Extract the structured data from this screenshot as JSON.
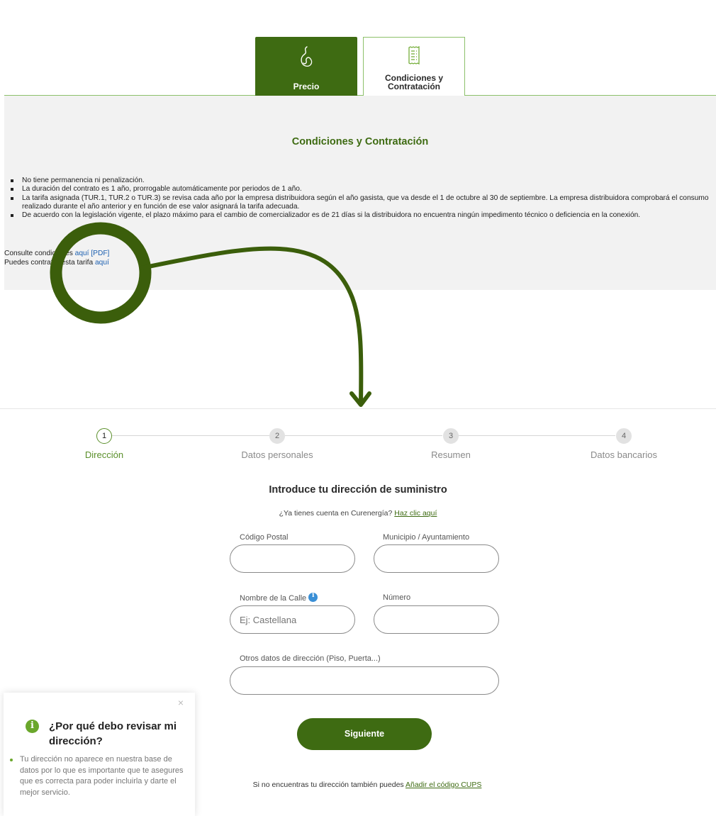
{
  "tabs": {
    "precio_label": "Precio",
    "condiciones_label": "Condiciones y\nContratación",
    "precio_icon": "flame-icon",
    "condiciones_icon": "receipt-icon"
  },
  "conditions": {
    "title": "Condiciones y Contratación",
    "items": [
      "No tiene permanencia ni penalización.",
      "La duración del contrato es 1 año, prorrogable automáticamente por periodos de 1 año.",
      "La tarifa asignada (TUR.1, TUR.2 o TUR.3) se revisa cada año por la empresa distribuidora según el año gasista, que va desde el 1 de octubre al 30 de septiembre. La empresa distribuidora comprobará el consumo realizado durante el año anterior y en función de ese valor asignará la tarifa adecuada.",
      "De acuerdo con la legislación vigente, el plazo máximo para el cambio de comercializador es de 21 días si la distribuidora no encuentra ningún impedimento técnico o deficiencia en la conexión."
    ],
    "consult_prefix": "Consulte condiciones ",
    "consult_link": "aquí [PDF]",
    "contract_prefix": "Puedes contratar esta tarifa ",
    "contract_link": "aquí"
  },
  "stepper": {
    "steps": [
      {
        "num": "1",
        "label": "Dirección"
      },
      {
        "num": "2",
        "label": "Datos personales"
      },
      {
        "num": "3",
        "label": "Resumen"
      },
      {
        "num": "4",
        "label": "Datos bancarios"
      }
    ],
    "active_index": 0
  },
  "form": {
    "title": "Introduce tu dirección de suministro",
    "account_prefix": "¿Ya tienes cuenta en Curenergía? ",
    "account_link": "Haz clic aquí",
    "postal_label": "Código Postal",
    "postal_value": "",
    "municipio_label": "Municipio / Ayuntamiento",
    "municipio_value": "",
    "calle_label": "Nombre de la Calle",
    "calle_placeholder": "Ej: Castellana",
    "numero_label": "Número",
    "numero_value": "",
    "otros_label": "Otros datos de dirección (Piso, Puerta...)",
    "otros_value": "",
    "next_label": "Siguiente",
    "cups_prefix": "Si no encuentras tu dirección también puedes ",
    "cups_link": "Añadir el código CUPS"
  },
  "tooltip": {
    "close": "×",
    "title": "¿Por qué debo revisar mi dirección?",
    "body": "Tu dirección no aparece en nuestra base de datos por lo que es importante que te asegures que es correcta para poder incluirla y darte el mejor servicio."
  },
  "colors": {
    "brand_green": "#3e6b12",
    "accent_green": "#6aa72b",
    "link_blue": "#1b5fb0",
    "info_blue": "#3a8fd6"
  }
}
